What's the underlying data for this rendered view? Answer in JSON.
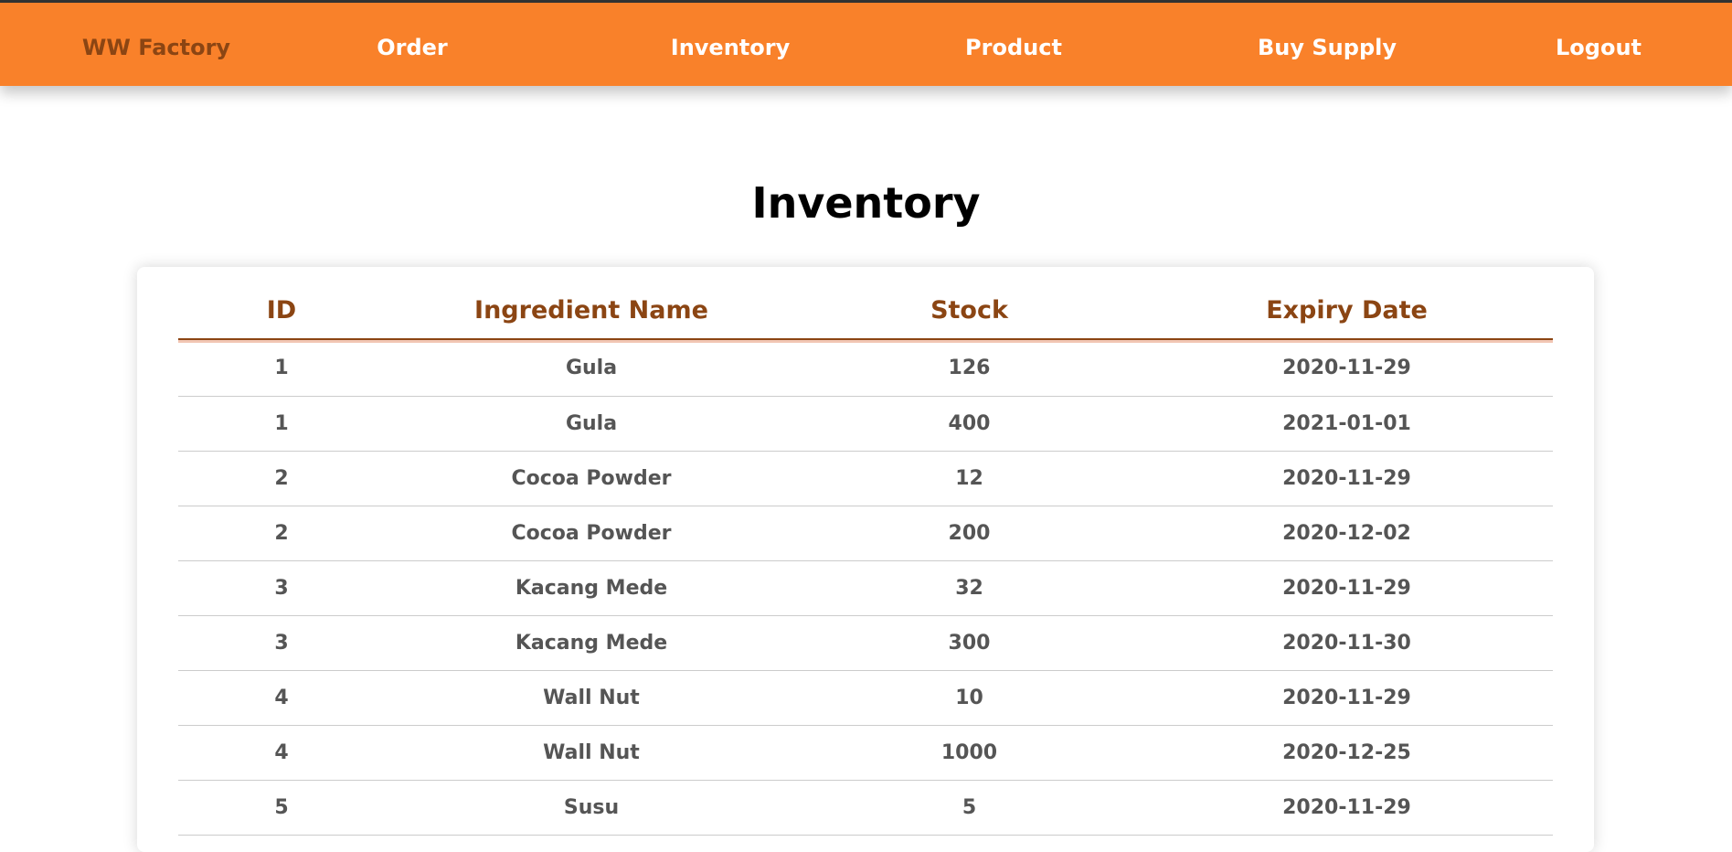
{
  "nav": {
    "brand": "WW Factory",
    "items": [
      "Order",
      "Inventory",
      "Product",
      "Buy Supply",
      "Logout"
    ]
  },
  "page": {
    "title": "Inventory"
  },
  "table": {
    "columns": [
      "ID",
      "Ingredient Name",
      "Stock",
      "Expiry Date"
    ],
    "rows": [
      [
        "1",
        "Gula",
        "126",
        "2020-11-29"
      ],
      [
        "1",
        "Gula",
        "400",
        "2021-01-01"
      ],
      [
        "2",
        "Cocoa Powder",
        "12",
        "2020-11-29"
      ],
      [
        "2",
        "Cocoa Powder",
        "200",
        "2020-12-02"
      ],
      [
        "3",
        "Kacang Mede",
        "32",
        "2020-11-29"
      ],
      [
        "3",
        "Kacang Mede",
        "300",
        "2020-11-30"
      ],
      [
        "4",
        "Wall Nut",
        "10",
        "2020-11-29"
      ],
      [
        "4",
        "Wall Nut",
        "1000",
        "2020-12-25"
      ],
      [
        "5",
        "Susu",
        "5",
        "2020-11-29"
      ]
    ]
  },
  "colors": {
    "navbar": "#f9812a",
    "brand": "#8b4513",
    "header_text": "#8b4513",
    "cell_text": "#555555"
  }
}
